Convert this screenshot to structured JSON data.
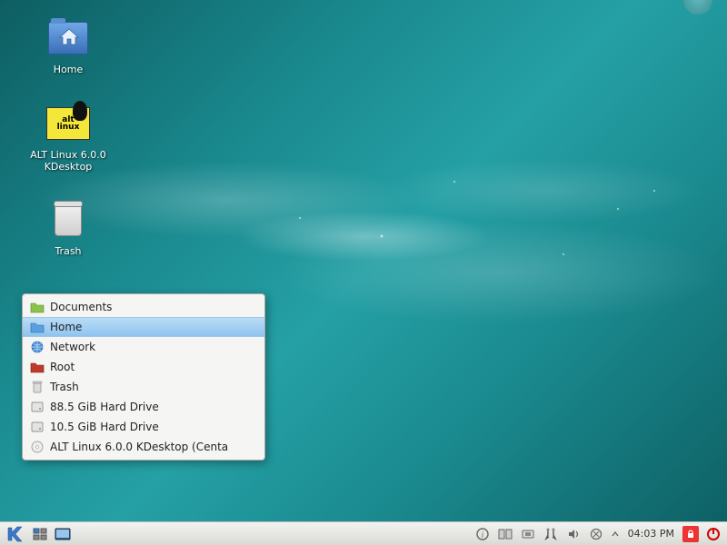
{
  "desktop": {
    "icons": [
      {
        "label": "Home"
      },
      {
        "label": "ALT Linux 6.0.0 KDesktop"
      },
      {
        "label": "Trash"
      }
    ]
  },
  "popup": {
    "items": [
      {
        "label": "Documents",
        "icon": "folder-green",
        "selected": false
      },
      {
        "label": "Home",
        "icon": "folder-blue",
        "selected": true
      },
      {
        "label": "Network",
        "icon": "globe",
        "selected": false
      },
      {
        "label": "Root",
        "icon": "folder-red",
        "selected": false
      },
      {
        "label": "Trash",
        "icon": "trash",
        "selected": false
      },
      {
        "label": "88.5 GiB Hard Drive",
        "icon": "drive",
        "selected": false
      },
      {
        "label": "10.5 GiB Hard Drive",
        "icon": "drive",
        "selected": false
      },
      {
        "label": "ALT Linux 6.0.0 KDesktop (Centa",
        "icon": "disc",
        "selected": false
      }
    ]
  },
  "panel": {
    "clock": "04:03 PM"
  },
  "alt_logo_text": "alt\nlinux"
}
